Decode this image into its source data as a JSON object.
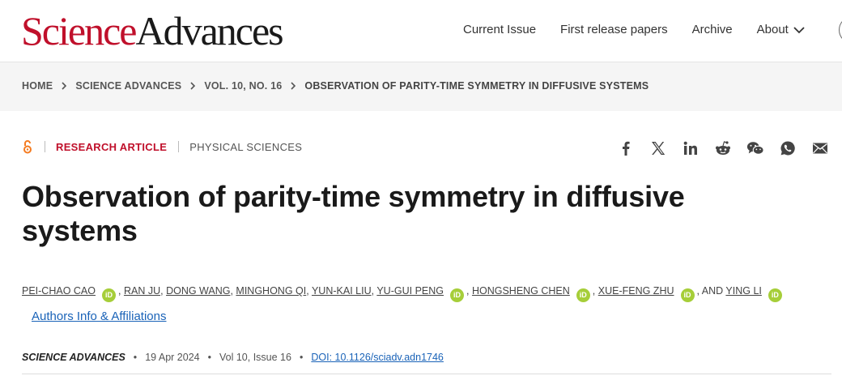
{
  "header": {
    "logo_science": "Science",
    "logo_advances": "Advances",
    "nav": [
      {
        "label": "Current Issue"
      },
      {
        "label": "First release papers"
      },
      {
        "label": "Archive"
      },
      {
        "label": "About"
      }
    ]
  },
  "breadcrumb": {
    "items": [
      {
        "label": "HOME"
      },
      {
        "label": "SCIENCE ADVANCES"
      },
      {
        "label": "VOL. 10, NO. 16"
      },
      {
        "label": "OBSERVATION OF PARITY-TIME SYMMETRY IN DIFFUSIVE SYSTEMS"
      }
    ]
  },
  "article": {
    "type": "RESEARCH ARTICLE",
    "subject": "PHYSICAL SCIENCES",
    "title": "Observation of parity-time symmetry in diffusive systems",
    "authors": {
      "a1": "PEI-CHAO CAO",
      "a2": "RAN JU",
      "a3": "DONG WANG",
      "a4": "MINGHONG QI",
      "a5": "YUN-KAI LIU",
      "a6": "YU-GUI PENG",
      "a7": "HONGSHENG CHEN",
      "a8": "XUE-FENG ZHU",
      "a9": "YING LI",
      "and": "AND"
    },
    "orcid_label": "iD",
    "affiliations_link": "Authors Info & Affiliations",
    "journal": "SCIENCE ADVANCES",
    "date": "19 Apr 2024",
    "volume_issue": "Vol 10, Issue 16",
    "doi": "DOI: 10.1126/sciadv.adn1746"
  },
  "share_icons": [
    "facebook-icon",
    "x-icon",
    "linkedin-icon",
    "reddit-icon",
    "wechat-icon",
    "whatsapp-icon",
    "email-icon"
  ],
  "colors": {
    "brand_red": "#c0102b",
    "link_blue": "#1a63b8",
    "orcid_green": "#a6ce39",
    "open_access_orange": "#f47b20"
  }
}
